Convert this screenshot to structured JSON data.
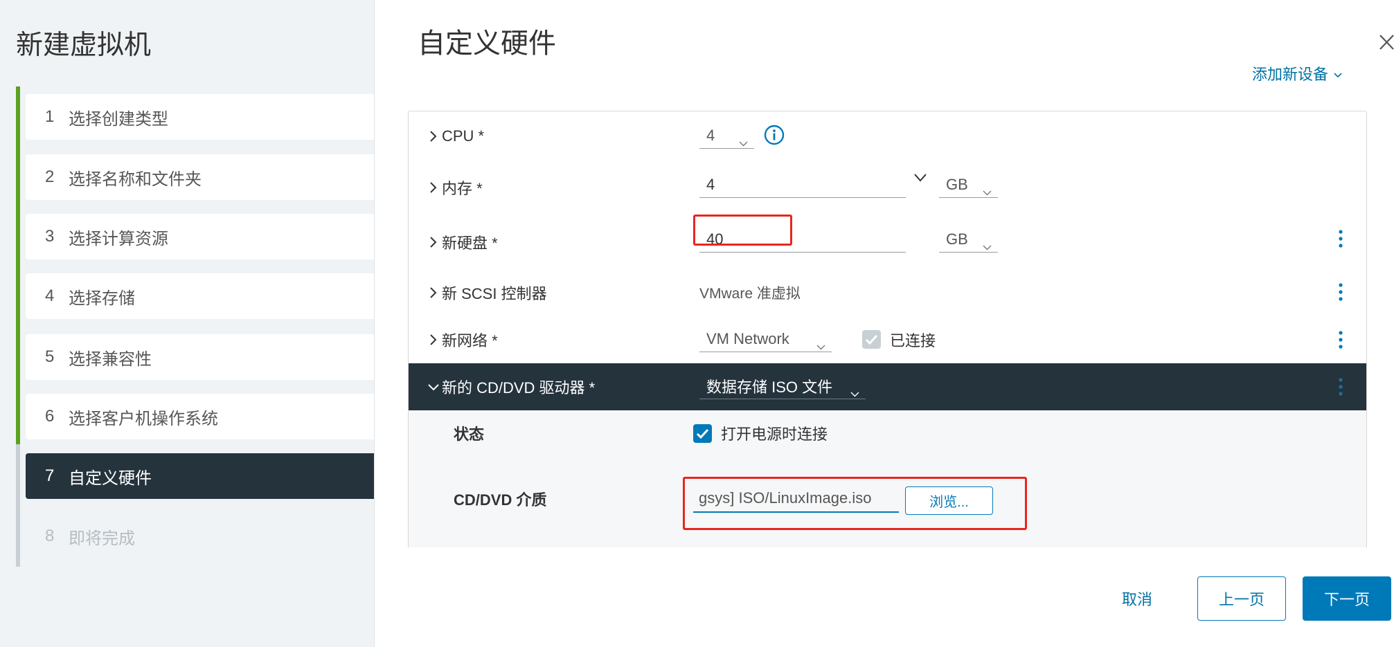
{
  "wizard": {
    "title": "新建虚拟机",
    "steps": [
      {
        "num": "1",
        "label": "选择创建类型"
      },
      {
        "num": "2",
        "label": "选择名称和文件夹"
      },
      {
        "num": "3",
        "label": "选择计算资源"
      },
      {
        "num": "4",
        "label": "选择存储"
      },
      {
        "num": "5",
        "label": "选择兼容性"
      },
      {
        "num": "6",
        "label": "选择客户机操作系统"
      },
      {
        "num": "7",
        "label": "自定义硬件"
      },
      {
        "num": "8",
        "label": "即将完成"
      }
    ]
  },
  "page": {
    "title": "自定义硬件",
    "add_device": "添加新设备"
  },
  "hardware": {
    "cpu": {
      "label": "CPU *",
      "value": "4"
    },
    "memory": {
      "label": "内存 *",
      "value": "4",
      "unit": "GB"
    },
    "disk": {
      "label": "新硬盘 *",
      "value": "40",
      "unit": "GB"
    },
    "scsi": {
      "label": "新 SCSI 控制器",
      "value": "VMware 准虚拟"
    },
    "network": {
      "label": "新网络 *",
      "value": "VM Network",
      "connected_label": "已连接",
      "connected": true
    },
    "cdrom": {
      "label": "新的 CD/DVD 驱动器 *",
      "value": "数据存储 ISO 文件",
      "status_label": "状态",
      "power_on_label": "打开电源时连接",
      "power_on_connect": true,
      "media_label": "CD/DVD 介质",
      "media_value": "gsys] ISO/LinuxImage.iso",
      "browse_label": "浏览..."
    }
  },
  "footer": {
    "cancel": "取消",
    "back": "上一页",
    "next": "下一页"
  },
  "icons": {
    "close": "close-icon",
    "add_device_caret": "chevron-down-icon",
    "row_toggle": "chevron-right-icon",
    "info": "info-icon",
    "row_menu": "more-vertical-icon",
    "checkbox": "checkbox-icon"
  },
  "colors": {
    "accent": "#0079b8",
    "selected_step": "#25333d",
    "completed_progress": "#5aa220",
    "pending_progress": "#c9d0d5",
    "annotation": "#e8261f"
  }
}
